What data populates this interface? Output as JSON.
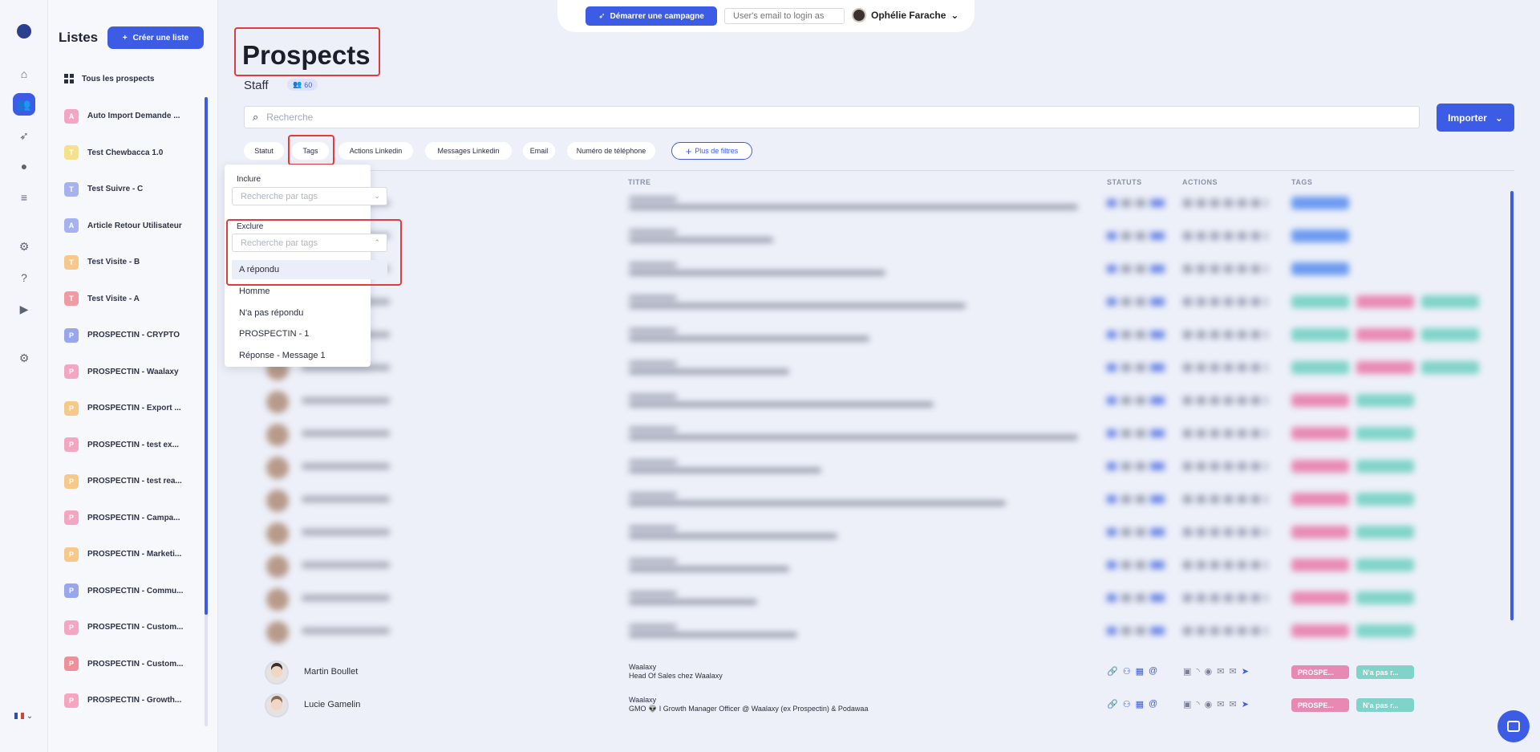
{
  "sidebar_lists": {
    "title": "Listes",
    "create_label": "Créer une liste",
    "all_label": "Tous les prospects",
    "items": [
      {
        "initial": "A",
        "label": "Auto Import Demande ...",
        "color": "#f4a6c0"
      },
      {
        "initial": "T",
        "label": "Test Chewbacca 1.0",
        "color": "#f6e08a"
      },
      {
        "initial": "T",
        "label": "Test Suivre - C",
        "color": "#a6b2ef"
      },
      {
        "initial": "A",
        "label": "Article Retour Utilisateur",
        "color": "#a6b2ef"
      },
      {
        "initial": "T",
        "label": "Test Visite - B",
        "color": "#f6c98a"
      },
      {
        "initial": "T",
        "label": "Test Visite - A",
        "color": "#f29aa3"
      },
      {
        "initial": "P",
        "label": "PROSPECTIN - CRYPTO",
        "color": "#98a6ee"
      },
      {
        "initial": "P",
        "label": "PROSPECTIN - Waalaxy",
        "color": "#f4a6c0"
      },
      {
        "initial": "P",
        "label": "PROSPECTIN - Export ...",
        "color": "#f6c98a"
      },
      {
        "initial": "P",
        "label": "PROSPECTIN - test ex...",
        "color": "#f4a6c0"
      },
      {
        "initial": "P",
        "label": "PROSPECTIN - test rea...",
        "color": "#f6c98a"
      },
      {
        "initial": "P",
        "label": "PROSPECTIN - Campa...",
        "color": "#f4a6c0"
      },
      {
        "initial": "P",
        "label": "PROSPECTIN - Marketi...",
        "color": "#f6c98a"
      },
      {
        "initial": "P",
        "label": "PROSPECTIN - Commu...",
        "color": "#98a6ee"
      },
      {
        "initial": "P",
        "label": "PROSPECTIN - Custom...",
        "color": "#f4a6c0"
      },
      {
        "initial": "P",
        "label": "PROSPECTIN - Custom...",
        "color": "#ee8f9a"
      },
      {
        "initial": "P",
        "label": "PROSPECTIN - Growth...",
        "color": "#f4a6c0"
      }
    ]
  },
  "topbar": {
    "campaign_label": "Démarrer une campagne",
    "email_placeholder": "User's email to login as",
    "user_name": "Ophélie Farache"
  },
  "page": {
    "title": "Prospects",
    "subtitle": "Staff",
    "count": "60",
    "search_placeholder": "Recherche",
    "import_label": "Importer"
  },
  "filters": {
    "statut": "Statut",
    "tags": "Tags",
    "actions_linkedin": "Actions Linkedin",
    "messages_linkedin": "Messages Linkedin",
    "email": "Email",
    "telephone": "Numéro de téléphone",
    "more": "Plus de filtres"
  },
  "table": {
    "headers": {
      "titre": "TITRE",
      "statuts": "STATUTS",
      "actions": "ACTIONS",
      "tags": "TAGS"
    },
    "rows": [
      {
        "name": "Martin Boullet",
        "company": "Waalaxy",
        "title": "Head Of Sales chez Waalaxy",
        "tag1": "PROSPE...",
        "tag2": "N'a pas r..."
      },
      {
        "name": "Lucie Gamelin",
        "company": "Waalaxy",
        "title": "GMO 👽 I Growth Manager Officer @ Waalaxy (ex Prospectin) & Podawaa",
        "tag1": "PROSPE...",
        "tag2": "N'a pas r..."
      }
    ]
  },
  "tag_dropdown": {
    "include_label": "Inclure",
    "include_placeholder": "Recherche par tags",
    "exclude_label": "Exclure",
    "exclude_placeholder": "Recherche par tags",
    "options": [
      "A répondu",
      "Homme",
      "N'a pas répondu",
      "PROSPECTIN - 1",
      "Réponse - Message 1"
    ]
  },
  "colors": {
    "accent": "#3d5ce6",
    "highlight": "#e23b3b",
    "tag_pink": "#e889b4",
    "tag_teal": "#7fd3c8"
  }
}
